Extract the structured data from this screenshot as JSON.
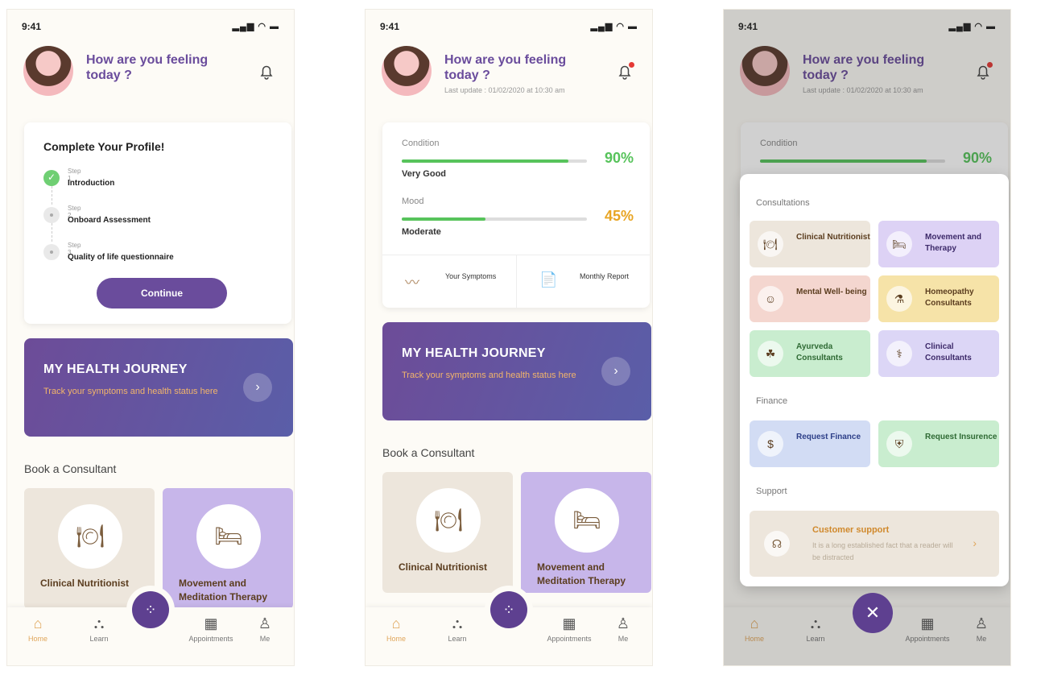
{
  "status": {
    "time": "9:41",
    "signal": "▂▄▆ ◠ ▬"
  },
  "header": {
    "greeting": "How are you feeling today ?",
    "last_update": "Last update : 01/02/2020 at 10:30 am"
  },
  "profile": {
    "title": "Complete Your Profile!",
    "steps": [
      {
        "step": "Step 1",
        "name": "Introduction"
      },
      {
        "step": "Step 2",
        "name": "Onboard Assessment"
      },
      {
        "step": "Step 3",
        "name": "Quality of life questionnaire"
      }
    ],
    "button": "Continue"
  },
  "journey": {
    "title": "MY HEALTH JOURNEY",
    "subtitle": "Track your symptoms and health status here",
    "arrow": "›"
  },
  "book": {
    "title": "Book a Consultant"
  },
  "tiles": [
    {
      "label": "Clinical Nutritionist",
      "icon": "🍽"
    },
    {
      "label": "Movement and Meditation Therapy",
      "icon": "🛏"
    }
  ],
  "metrics": [
    {
      "title": "Condition",
      "level": "Very Good",
      "pct_text": "90%",
      "pct": 0.9,
      "color": "#57c35b"
    },
    {
      "title": "Mood",
      "level": "Moderate",
      "pct_text": "45%",
      "pct": 0.45,
      "color": "#e8a524"
    }
  ],
  "metric_links": [
    {
      "label": "Your Symptoms",
      "icon": "〰"
    },
    {
      "label": "Monthly Report",
      "icon": "📄"
    }
  ],
  "tabs": [
    {
      "label": "Home",
      "icon": "⌂"
    },
    {
      "label": "Learn",
      "icon": "⛬"
    },
    {
      "label": "Appointments",
      "icon": "▦"
    },
    {
      "label": "Me",
      "icon": "♙"
    }
  ],
  "fab": {
    "icon": "⁘",
    "close_icon": "✕"
  },
  "menu": {
    "consultations": "Consultations",
    "finance": "Finance",
    "support": "Support",
    "consult_items": [
      {
        "label": "Clinical Nutritionist",
        "icon": "🍽",
        "bg": "#ede6dc",
        "fg": "#5b3d1f"
      },
      {
        "label": "Movement and Therapy",
        "icon": "🛏",
        "bg": "#ddd2f5",
        "fg": "#3d2a6a"
      },
      {
        "label": "Mental Well- being",
        "icon": "☺",
        "bg": "#f4d6cf",
        "fg": "#5b3d1f"
      },
      {
        "label": "Homeopathy Consultants",
        "icon": "⚗",
        "bg": "#f6e3a8",
        "fg": "#5b3d1f"
      },
      {
        "label": "Ayurveda Consultants",
        "icon": "☘",
        "bg": "#c9edcf",
        "fg": "#2f6a34"
      },
      {
        "label": "Clinical Consultants",
        "icon": "⚕",
        "bg": "#dcd6f6",
        "fg": "#3d2a6a"
      }
    ],
    "finance_items": [
      {
        "label": "Request Finance",
        "icon": "$",
        "bg": "#d2dcf4",
        "fg": "#2d3f88"
      },
      {
        "label": "Request Insurence",
        "icon": "⛨",
        "bg": "#c9edcf",
        "fg": "#2f6a34"
      }
    ],
    "support_item": {
      "title": "Customer support",
      "desc": "It is a long established fact that a reader will be distracted",
      "icon": "☊",
      "chev": "›"
    }
  }
}
